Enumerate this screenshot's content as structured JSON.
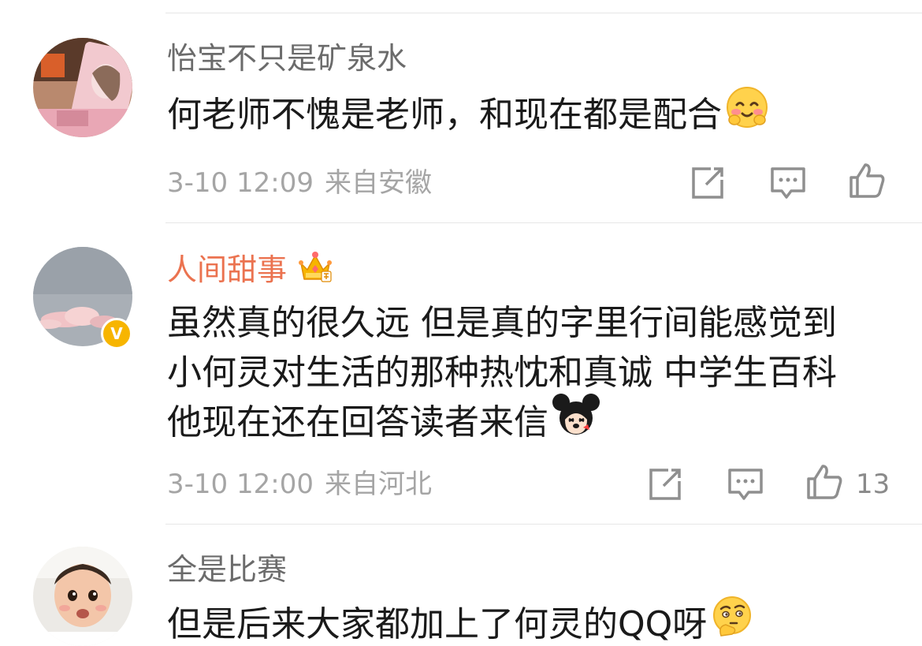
{
  "comments": [
    {
      "username": "怡宝不只是矿泉水",
      "lines": [
        "何老师不愧是老师，和现在都是配合"
      ],
      "emoji": "blush-emoji",
      "time": "3-10 12:09",
      "location": "来自安徽",
      "likes": ""
    },
    {
      "username": "人间甜事",
      "vip": true,
      "verified_mark": "V",
      "lines": [
        "虽然真的很久远 但是真的字里行间能感觉到",
        "小何灵对生活的那种热忱和真诚  中学生百科",
        "他现在还在回答读者来信"
      ],
      "emoji": "mickey-emoji",
      "time": "3-10 12:00",
      "location": "来自河北",
      "likes": "13"
    },
    {
      "username": "全是比赛",
      "lines": [
        "但是后来大家都加上了何灵的QQ呀"
      ],
      "emoji": "thinking-emoji",
      "time": "",
      "location": "",
      "likes": ""
    }
  ],
  "icons": {
    "repost": "repost-icon",
    "reply": "comment-icon",
    "like": "like-icon"
  },
  "colors": {
    "username": "#6b6b6b",
    "vip_username": "#eb7350",
    "text": "#1a1a1a",
    "meta": "#a5a5a5",
    "verified": "#f7b500"
  }
}
